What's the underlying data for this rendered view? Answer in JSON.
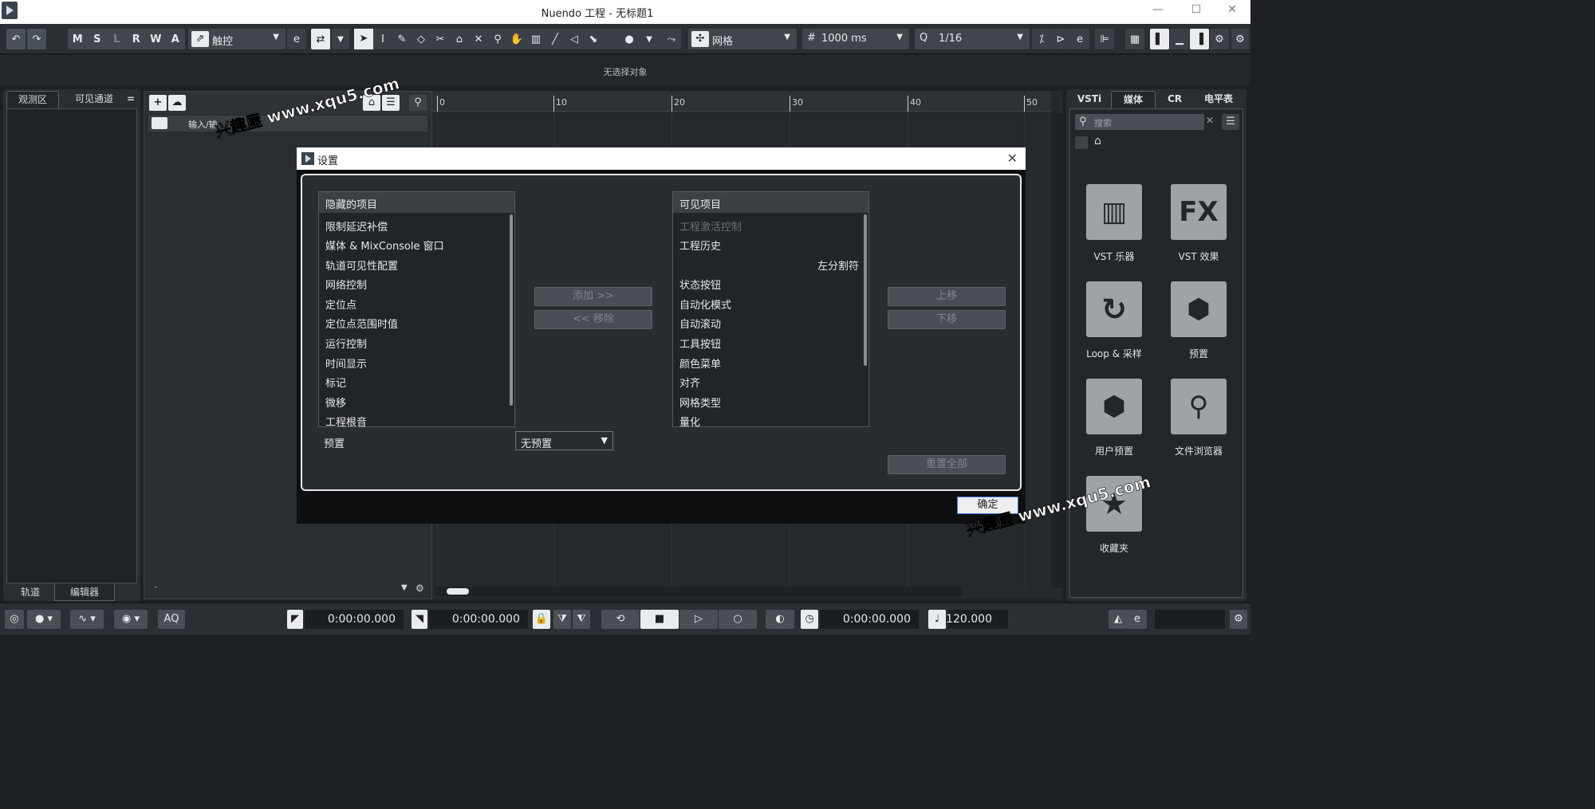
{
  "window": {
    "title": "Nuendo 工程 - 无标题1",
    "minimize": "—",
    "maximize": "☐",
    "close": "✕"
  },
  "toolbar": {
    "undo_icon": "↶",
    "redo_icon": "↷",
    "mode_buttons": [
      "M",
      "S",
      "L",
      "R",
      "W",
      "A"
    ],
    "automation_mode": "触控",
    "snap_type": "网格",
    "grid_value": "1000 ms",
    "quantize_value": "1/16"
  },
  "infoline": {
    "message": "无选择对象"
  },
  "left_zone": {
    "tabs": [
      "观测区",
      "可见通道"
    ],
    "menu_icon": "=",
    "bottom_tabs": [
      "轨道",
      "编辑器"
    ]
  },
  "track_list": {
    "add_icon": "+",
    "track_name": "输入/输",
    "bottom_dash": "-"
  },
  "ruler": {
    "marks": [
      "0",
      "10",
      "20",
      "30",
      "40",
      "50"
    ]
  },
  "right_zone": {
    "tabs": [
      "VSTi",
      "媒体",
      "CR",
      "电平表"
    ],
    "search_placeholder": "搜索",
    "tiles": [
      {
        "label": "VST 乐器",
        "icon": "piano-keys-icon"
      },
      {
        "label": "VST 效果",
        "icon": "fx-icon",
        "glyph": "FX"
      },
      {
        "label": "Loop & 采样",
        "icon": "loop-icon"
      },
      {
        "label": "预置",
        "icon": "hexagons-icon"
      },
      {
        "label": "用户预置",
        "icon": "user-hexagon-icon"
      },
      {
        "label": "文件浏览器",
        "icon": "file-browser-icon"
      },
      {
        "label": "收藏夹",
        "icon": "star-icon"
      }
    ]
  },
  "dialog": {
    "title": "设置",
    "hidden_header": "隐藏的项目",
    "hidden_items": [
      "限制延迟补偿",
      "媒体 & MixConsole 窗口",
      "轨道可见性配置",
      "网络控制",
      "定位点",
      "定位点范围时值",
      "运行控制",
      "时间显示",
      "标记",
      "微移",
      "工程根音"
    ],
    "visible_header": "可见项目",
    "visible_items": [
      "工程激活控制",
      "工程历史",
      "左分割符",
      "状态按钮",
      "自动化模式",
      "自动滚动",
      "工具按钮",
      "颜色菜单",
      "对齐",
      "网格类型",
      "量化"
    ],
    "add_button": "添加 >>",
    "remove_button": "<< 移除",
    "move_up_button": "上移",
    "move_down_button": "下移",
    "preset_label": "预置",
    "preset_value": "无预置",
    "reset_all_button": "重置全部",
    "ok_button": "确定"
  },
  "watermark": {
    "text": "兴趣屋 www.xqu5.com"
  },
  "transport": {
    "aq_label": "AQ",
    "left_locator": "0:00:00.000",
    "right_locator": "0:00:00.000",
    "position": "0:00:00.000",
    "tempo": "120.000"
  },
  "colors": {
    "background": "#1e2124",
    "panel": "#2a2e32",
    "accent_blue": "#3d7bd4",
    "tile_gray": "#9ea3a8"
  }
}
